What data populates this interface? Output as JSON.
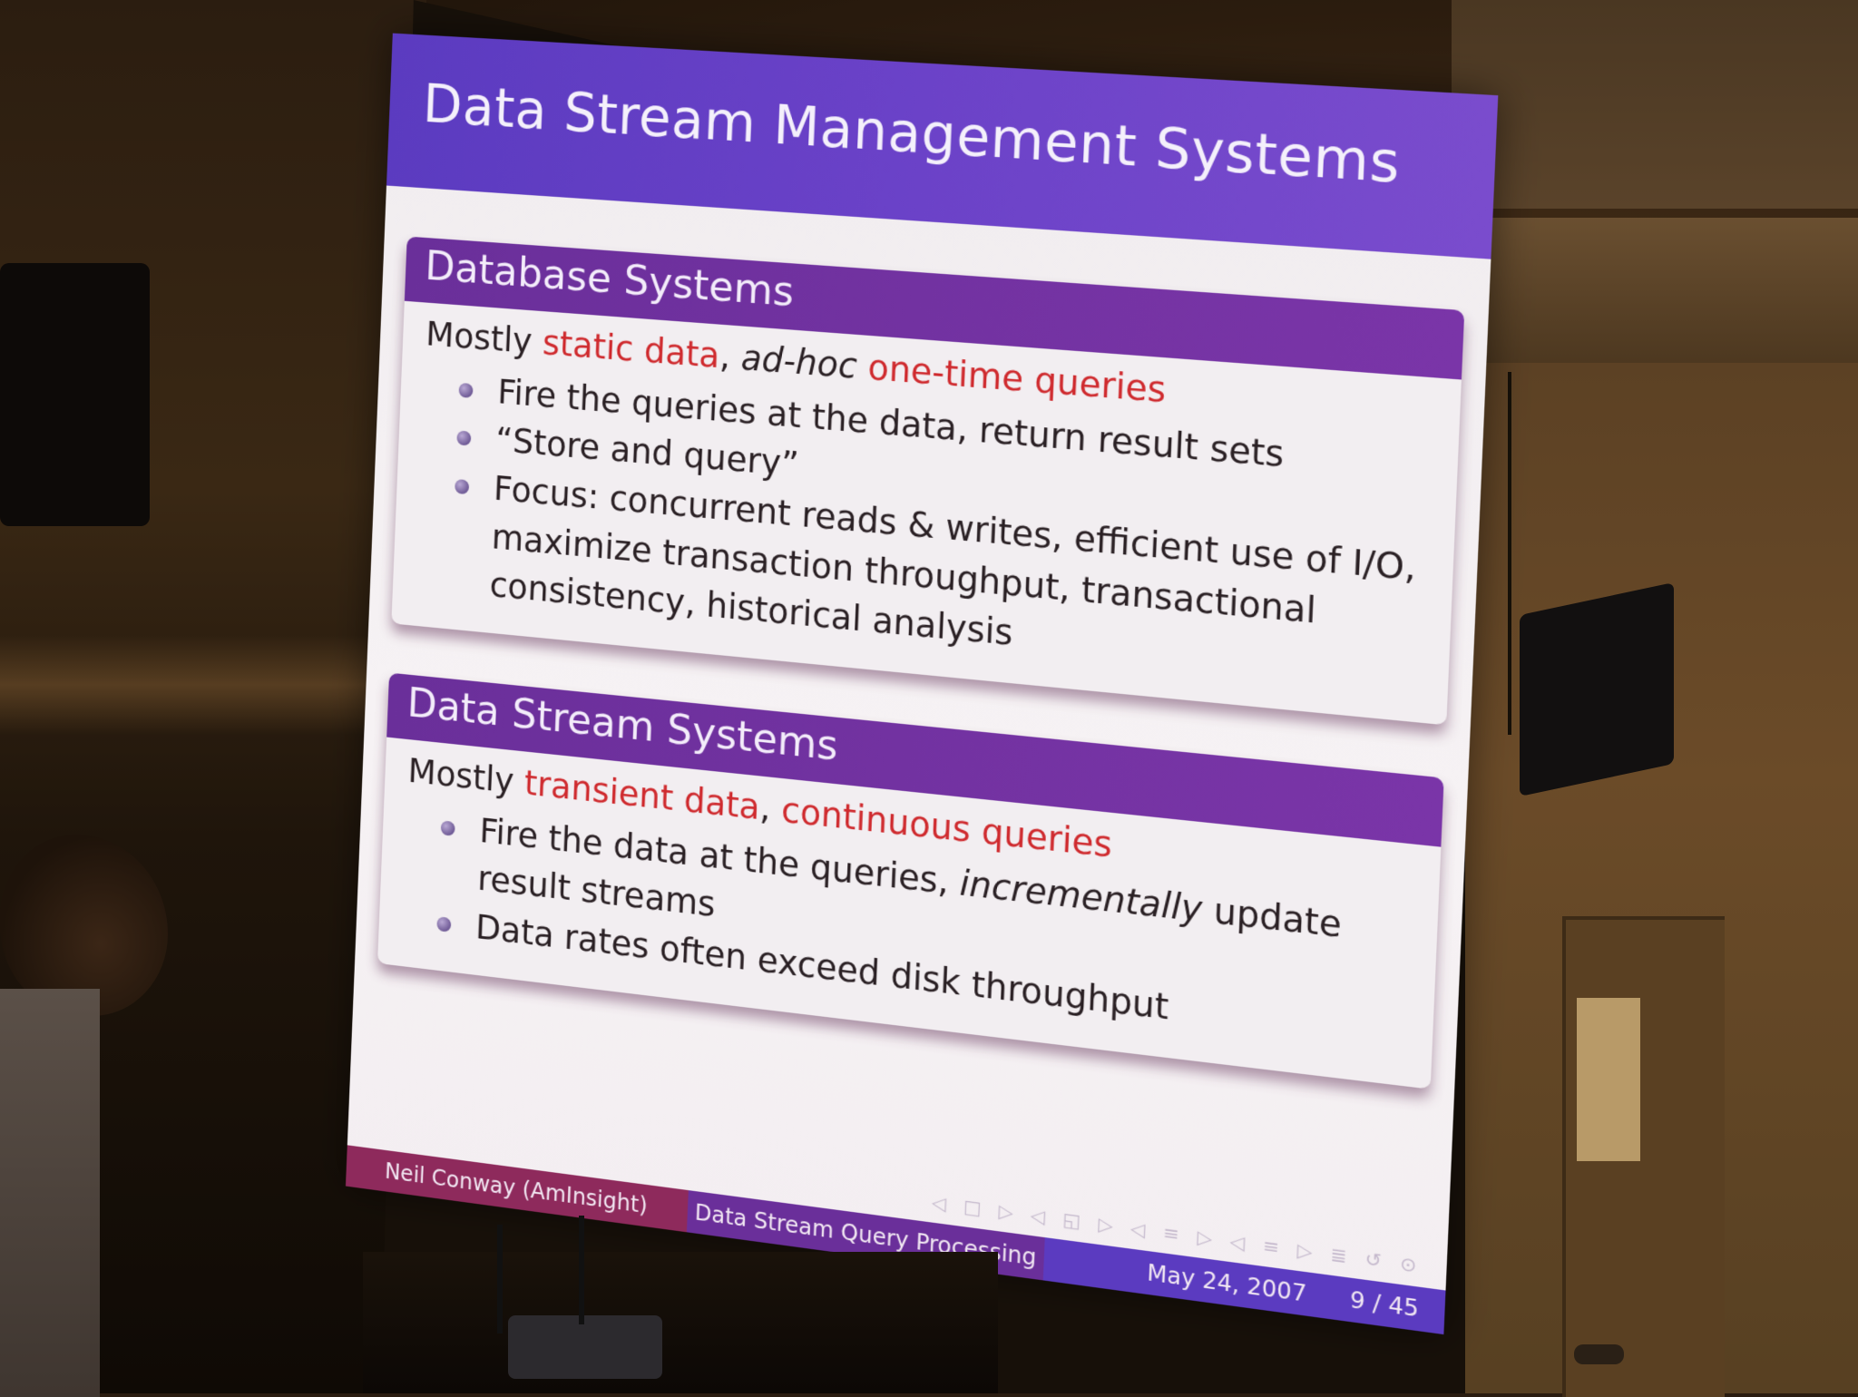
{
  "slide": {
    "title": "Data Stream Management Systems",
    "blocks": [
      {
        "title": "Database Systems",
        "lead": {
          "prefix": "Mostly ",
          "highlight1": "static data",
          "middle1": ", ",
          "italic": "ad-hoc",
          "middle2": " ",
          "highlight2": "one-time queries"
        },
        "items": [
          "Fire the queries at the data, return result sets",
          "“Store and query”",
          "Focus: concurrent reads & writes, efficient use of I/O, maximize transaction throughput, transactional consistency, historical analysis"
        ]
      },
      {
        "title": "Data Stream Systems",
        "lead": {
          "prefix": "Mostly ",
          "highlight1": "transient data",
          "middle1": ", ",
          "highlight2": "continuous queries"
        },
        "items": [
          {
            "before": "Fire the data at the queries, ",
            "italic": "incrementally",
            "after": " update result streams"
          },
          "Data rates often exceed disk throughput"
        ]
      }
    ],
    "footer": {
      "author": "Neil Conway  (AmInsight)",
      "talk_title": "Data Stream Query Processing",
      "date": "May 24, 2007",
      "page": "9 / 45"
    },
    "colors": {
      "header_purple": "#5b3bc0",
      "block_title_purple": "#6a2f9a",
      "highlight_red": "#cf2a2e",
      "footer_magenta": "#8e2a5c"
    }
  }
}
